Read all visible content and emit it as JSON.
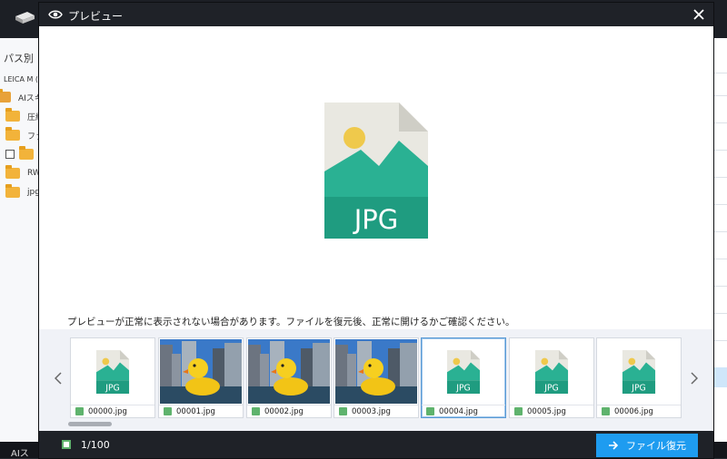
{
  "background": {
    "sidebar_title": "パス別",
    "tree_items": [
      {
        "label": "LEICA M (F"
      },
      {
        "label": "AIスキャ"
      },
      {
        "label": "圧縮"
      },
      {
        "label": "ファ"
      },
      {
        "label": ""
      },
      {
        "label": "RW"
      },
      {
        "label": "jpg"
      }
    ],
    "bottom_text": "AIス"
  },
  "modal": {
    "title": "プレビュー",
    "big_icon_label": "JPG",
    "notice": "プレビューが正常に表示されない場合があります。ファイルを復元後、正常に開けるかご確認ください。",
    "thumbnails": [
      {
        "name": "00000.jpg",
        "kind": "jpg-icon",
        "label": "JPG"
      },
      {
        "name": "00001.jpg",
        "kind": "photo-duck"
      },
      {
        "name": "00002.jpg",
        "kind": "photo-duck"
      },
      {
        "name": "00003.jpg",
        "kind": "photo-duck"
      },
      {
        "name": "00004.jpg",
        "kind": "jpg-icon",
        "label": "JPG",
        "selected": true
      },
      {
        "name": "00005.jpg",
        "kind": "jpg-icon",
        "label": "JPG"
      },
      {
        "name": "00006.jpg",
        "kind": "jpg-icon",
        "label": "JPG"
      }
    ],
    "footer": {
      "count": "1/100",
      "recover_label": "ファイル復元"
    }
  },
  "colors": {
    "header_bg": "#1f2228",
    "accent_blue": "#1e9cf0",
    "check_green": "#5fb36d",
    "jpg_green": "#2ab193"
  }
}
